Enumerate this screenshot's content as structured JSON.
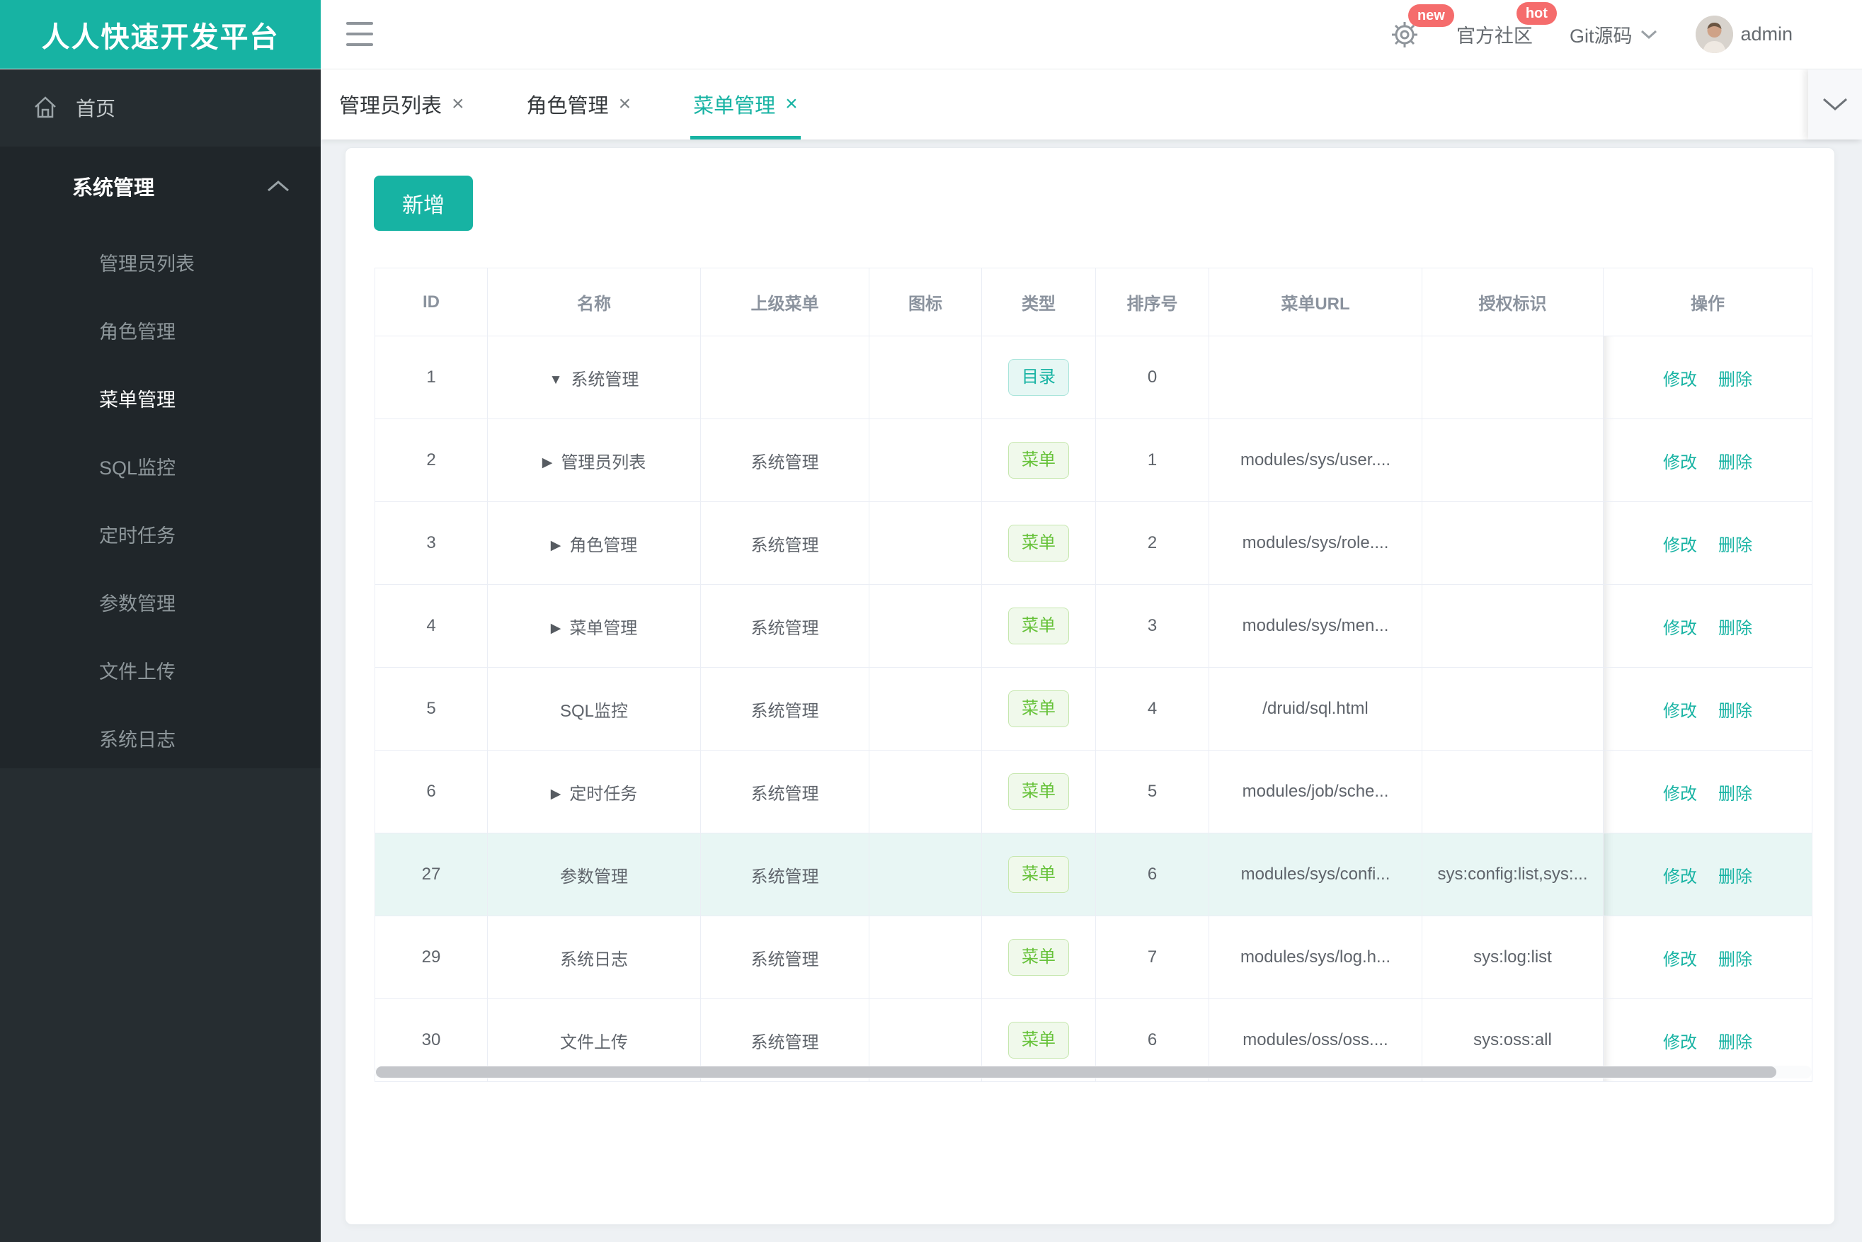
{
  "app": {
    "title": "人人快速开发平台"
  },
  "header": {
    "gear_badge": "new",
    "community": {
      "label": "官方社区",
      "badge": "hot"
    },
    "git": {
      "label": "Git源码"
    },
    "user": {
      "name": "admin"
    }
  },
  "sidebar": {
    "home": "首页",
    "group": {
      "label": "系统管理"
    },
    "items": [
      {
        "label": "管理员列表"
      },
      {
        "label": "角色管理"
      },
      {
        "label": "菜单管理",
        "active": true
      },
      {
        "label": "SQL监控"
      },
      {
        "label": "定时任务"
      },
      {
        "label": "参数管理"
      },
      {
        "label": "文件上传"
      },
      {
        "label": "系统日志"
      }
    ]
  },
  "tabbar": {
    "close_glyph": "×",
    "tabs": [
      {
        "label": "管理员列表"
      },
      {
        "label": "角色管理"
      },
      {
        "label": "菜单管理",
        "active": true
      }
    ]
  },
  "main": {
    "add_button": "新增",
    "table": {
      "columns": [
        "ID",
        "名称",
        "上级菜单",
        "图标",
        "类型",
        "排序号",
        "菜单URL",
        "授权标识",
        "操作"
      ],
      "op_edit": "修改",
      "op_delete": "删除",
      "rows": [
        {
          "id": "1",
          "arrow": "▼",
          "name": "系统管理",
          "parent": "",
          "icon": "",
          "type": "目录",
          "order": "0",
          "url": "",
          "perms": ""
        },
        {
          "id": "2",
          "arrow": "▶",
          "name": "管理员列表",
          "parent": "系统管理",
          "icon": "",
          "type": "菜单",
          "order": "1",
          "url": "modules/sys/user....",
          "perms": ""
        },
        {
          "id": "3",
          "arrow": "▶",
          "name": "角色管理",
          "parent": "系统管理",
          "icon": "",
          "type": "菜单",
          "order": "2",
          "url": "modules/sys/role....",
          "perms": ""
        },
        {
          "id": "4",
          "arrow": "▶",
          "name": "菜单管理",
          "parent": "系统管理",
          "icon": "",
          "type": "菜单",
          "order": "3",
          "url": "modules/sys/men...",
          "perms": ""
        },
        {
          "id": "5",
          "arrow": "",
          "name": "SQL监控",
          "parent": "系统管理",
          "icon": "",
          "type": "菜单",
          "order": "4",
          "url": "/druid/sql.html",
          "perms": ""
        },
        {
          "id": "6",
          "arrow": "▶",
          "name": "定时任务",
          "parent": "系统管理",
          "icon": "",
          "type": "菜单",
          "order": "5",
          "url": "modules/job/sche...",
          "perms": ""
        },
        {
          "id": "27",
          "arrow": "",
          "name": "参数管理",
          "parent": "系统管理",
          "icon": "",
          "type": "菜单",
          "order": "6",
          "url": "modules/sys/confi...",
          "perms": "sys:config:list,sys:..."
        },
        {
          "id": "29",
          "arrow": "",
          "name": "系统日志",
          "parent": "系统管理",
          "icon": "",
          "type": "菜单",
          "order": "7",
          "url": "modules/sys/log.h...",
          "perms": "sys:log:list"
        },
        {
          "id": "30",
          "arrow": "",
          "name": "文件上传",
          "parent": "系统管理",
          "icon": "",
          "type": "菜单",
          "order": "6",
          "url": "modules/oss/oss....",
          "perms": "sys:oss:all"
        }
      ]
    }
  },
  "colors": {
    "accent_teal": "#17b3a3",
    "badge_red": "#f56c6c",
    "tag_menu_green": "#67c23a",
    "row_highlight": "#e8f6f4",
    "sidebar_bg": "#262d31",
    "sidebar_submenu_bg": "#20262a"
  }
}
